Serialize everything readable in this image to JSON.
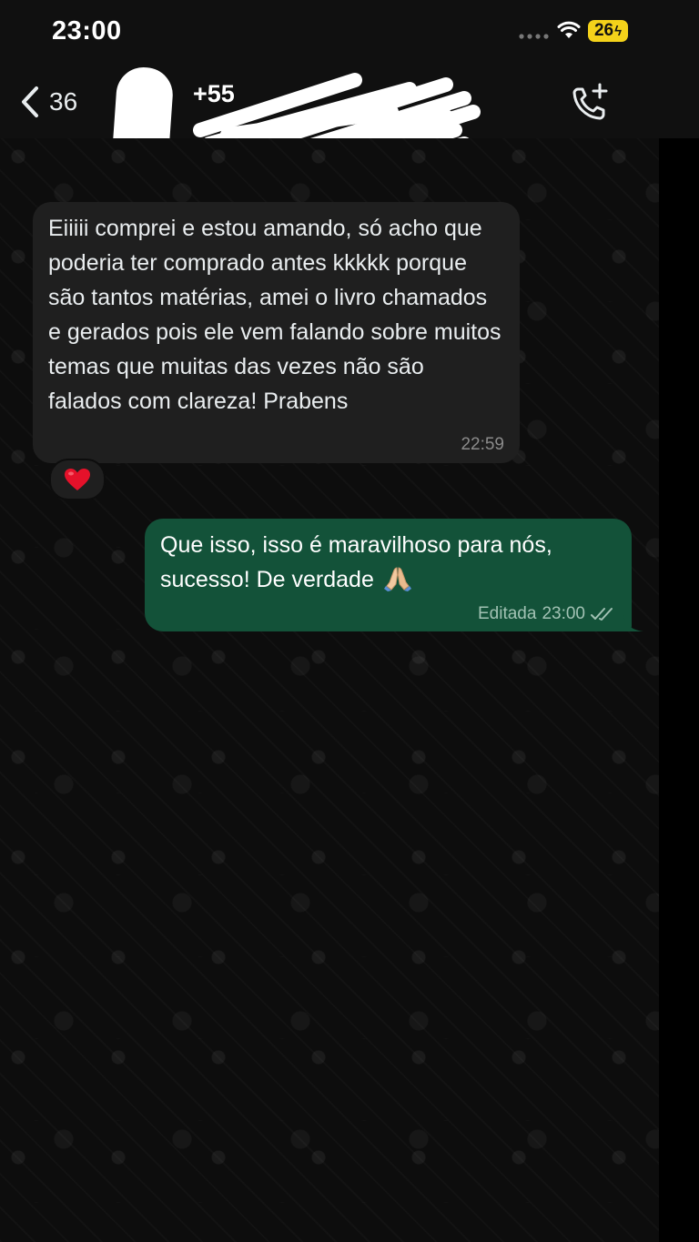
{
  "status_bar": {
    "time": "23:00",
    "battery": "26"
  },
  "header": {
    "back_count": "36",
    "contact_name_visible": "+55"
  },
  "messages": [
    {
      "direction": "incoming",
      "text": "Eiiiii comprei e estou amando, só acho que poderia ter comprado antes kkkkk porque são tantos matérias, amei o livro chamados e gerados pois ele vem falando sobre muitos temas que muitas das vezes não são falados com clareza! Prabens",
      "time": "22:59",
      "reaction": "heart-emoji"
    },
    {
      "direction": "outgoing",
      "text": "Que isso, isso é maravilhoso para nós, sucesso! De verdade",
      "emoji": "folded-hands-emoji",
      "edited_label": "Editada",
      "time": "23:00",
      "status": "read"
    }
  ],
  "colors": {
    "incoming_bubble": "#1f1f1f",
    "outgoing_bubble": "#135239",
    "background": "#0d0d0d",
    "battery": "#f4d21a"
  }
}
